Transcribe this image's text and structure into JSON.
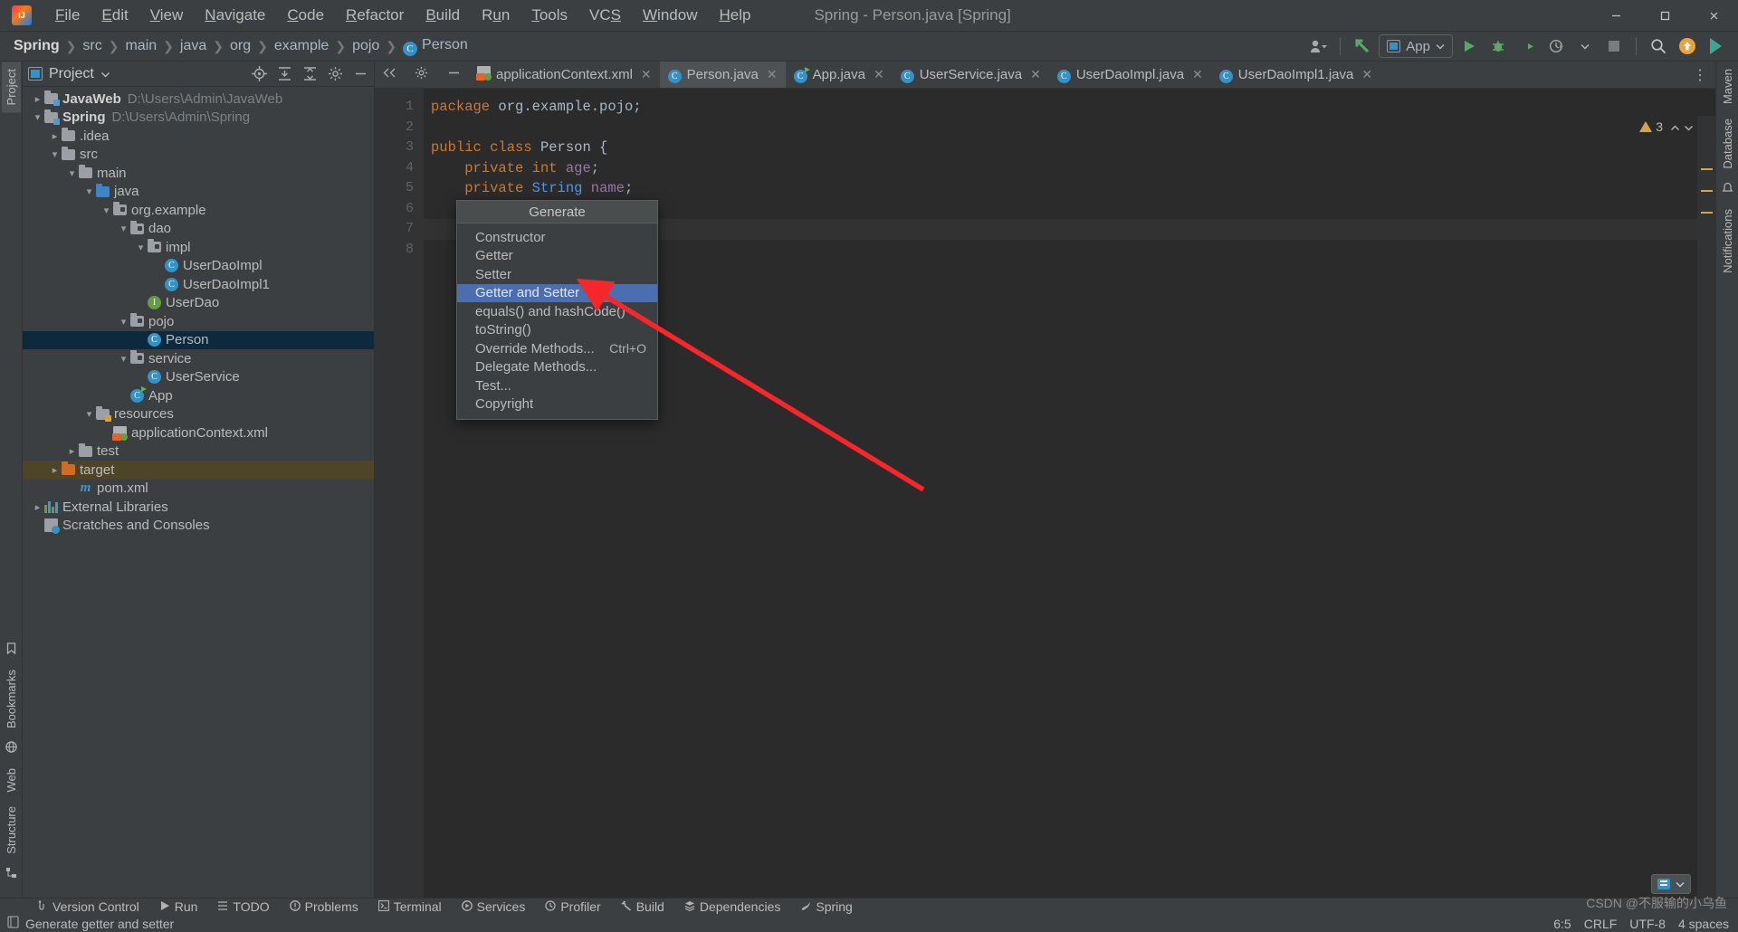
{
  "window": {
    "title": "Spring - Person.java [Spring]",
    "logo_icon": "intellij-idea-logo",
    "minimize_glyph": "─",
    "maximize_glyph": "❐",
    "close_glyph": "✕"
  },
  "menubar": [
    {
      "label": "File",
      "mnemonic": "F"
    },
    {
      "label": "Edit",
      "mnemonic": "E"
    },
    {
      "label": "View",
      "mnemonic": "V"
    },
    {
      "label": "Navigate",
      "mnemonic": "N"
    },
    {
      "label": "Code",
      "mnemonic": "C"
    },
    {
      "label": "Refactor",
      "mnemonic": "R"
    },
    {
      "label": "Build",
      "mnemonic": "B"
    },
    {
      "label": "Run",
      "mnemonic": "u"
    },
    {
      "label": "Tools",
      "mnemonic": "T"
    },
    {
      "label": "VCS",
      "mnemonic": "S"
    },
    {
      "label": "Window",
      "mnemonic": "W"
    },
    {
      "label": "Help",
      "mnemonic": "H"
    }
  ],
  "breadcrumb": [
    {
      "label": "Spring",
      "bold": true,
      "icon": ""
    },
    {
      "label": "src",
      "bold": false,
      "icon": ""
    },
    {
      "label": "main",
      "bold": false,
      "icon": ""
    },
    {
      "label": "java",
      "bold": false,
      "icon": ""
    },
    {
      "label": "org",
      "bold": false,
      "icon": ""
    },
    {
      "label": "example",
      "bold": false,
      "icon": ""
    },
    {
      "label": "pojo",
      "bold": false,
      "icon": ""
    },
    {
      "label": "Person",
      "bold": false,
      "icon": "class-icon"
    }
  ],
  "toolbar": {
    "run_config": "App",
    "run_config_icon": "app-window-icon",
    "user_icon": "user-account-icon",
    "updates_icon": "update-arrow-icon",
    "run_icon": "run-play-icon",
    "debug_icon": "debug-bug-icon",
    "coverage_icon": "run-with-coverage-icon",
    "profiler_icon": "profiler-clock-icon",
    "stop_icon": "stop-square-icon",
    "search_icon": "search-magnifier-icon",
    "notification_icon": "notification-update-icon",
    "ide_icon": "ide-feature-icon"
  },
  "project_panel": {
    "title": "Project",
    "dropdown_icon": "chevron-down-icon",
    "header_icons": [
      "locate-target-icon",
      "expand-all-icon",
      "collapse-all-icon",
      "settings-gear-icon",
      "hide-panel-icon"
    ],
    "tree": [
      {
        "label": "JavaWeb",
        "sub": "D:\\Users\\Admin\\JavaWeb",
        "indent": 0,
        "arrow": "›",
        "icon": "module-folder",
        "bold": true
      },
      {
        "label": "Spring",
        "sub": "D:\\Users\\Admin\\Spring",
        "indent": 0,
        "arrow": "⌄",
        "icon": "module-folder",
        "bold": true
      },
      {
        "label": ".idea",
        "sub": "",
        "indent": 1,
        "arrow": "›",
        "icon": "folder",
        "bold": false
      },
      {
        "label": "src",
        "sub": "",
        "indent": 1,
        "arrow": "⌄",
        "icon": "folder",
        "bold": false
      },
      {
        "label": "main",
        "sub": "",
        "indent": 2,
        "arrow": "⌄",
        "icon": "folder",
        "bold": false
      },
      {
        "label": "java",
        "sub": "",
        "indent": 3,
        "arrow": "⌄",
        "icon": "source-folder",
        "bold": false
      },
      {
        "label": "org.example",
        "sub": "",
        "indent": 4,
        "arrow": "⌄",
        "icon": "package",
        "bold": false
      },
      {
        "label": "dao",
        "sub": "",
        "indent": 5,
        "arrow": "⌄",
        "icon": "package",
        "bold": false
      },
      {
        "label": "impl",
        "sub": "",
        "indent": 6,
        "arrow": "⌄",
        "icon": "package",
        "bold": false
      },
      {
        "label": "UserDaoImpl",
        "sub": "",
        "indent": 7,
        "arrow": "",
        "icon": "class",
        "bold": false
      },
      {
        "label": "UserDaoImpl1",
        "sub": "",
        "indent": 7,
        "arrow": "",
        "icon": "class",
        "bold": false
      },
      {
        "label": "UserDao",
        "sub": "",
        "indent": 6,
        "arrow": "",
        "icon": "interface",
        "bold": false
      },
      {
        "label": "pojo",
        "sub": "",
        "indent": 5,
        "arrow": "⌄",
        "icon": "package",
        "bold": false
      },
      {
        "label": "Person",
        "sub": "",
        "indent": 6,
        "arrow": "",
        "icon": "class",
        "bold": false,
        "state": "selected"
      },
      {
        "label": "service",
        "sub": "",
        "indent": 5,
        "arrow": "⌄",
        "icon": "package",
        "bold": false
      },
      {
        "label": "UserService",
        "sub": "",
        "indent": 6,
        "arrow": "",
        "icon": "class",
        "bold": false
      },
      {
        "label": "App",
        "sub": "",
        "indent": 5,
        "arrow": "",
        "icon": "runnable-class",
        "bold": false
      },
      {
        "label": "resources",
        "sub": "",
        "indent": 3,
        "arrow": "⌄",
        "icon": "resource-folder",
        "bold": false
      },
      {
        "label": "applicationContext.xml",
        "sub": "",
        "indent": 4,
        "arrow": "",
        "icon": "spring-xml",
        "bold": false
      },
      {
        "label": "test",
        "sub": "",
        "indent": 2,
        "arrow": "›",
        "icon": "folder",
        "bold": false
      },
      {
        "label": "target",
        "sub": "",
        "indent": 1,
        "arrow": "›",
        "icon": "target-folder",
        "bold": false,
        "state": "target-hl"
      },
      {
        "label": "pom.xml",
        "sub": "",
        "indent": 2,
        "arrow": "",
        "icon": "maven",
        "bold": false
      },
      {
        "label": "External Libraries",
        "sub": "",
        "indent": 0,
        "arrow": "›",
        "icon": "libraries",
        "bold": false
      },
      {
        "label": "Scratches and Consoles",
        "sub": "",
        "indent": 0,
        "arrow": "",
        "icon": "scratches",
        "bold": false
      }
    ]
  },
  "editor": {
    "tabs": [
      {
        "label": "applicationContext.xml",
        "icon": "spring-xml-icon",
        "active": false
      },
      {
        "label": "Person.java",
        "icon": "class-icon",
        "active": true
      },
      {
        "label": "App.java",
        "icon": "runnable-class-icon",
        "active": false
      },
      {
        "label": "UserService.java",
        "icon": "class-icon",
        "active": false
      },
      {
        "label": "UserDaoImpl.java",
        "icon": "class-icon",
        "active": false
      },
      {
        "label": "UserDaoImpl1.java",
        "icon": "class-icon",
        "active": false
      }
    ],
    "more_tabs_icon": "more-options-icon",
    "line_numbers": [
      "1",
      "2",
      "3",
      "4",
      "5",
      "6",
      "7",
      "8"
    ],
    "code_lines": [
      [
        {
          "t": "package",
          "c": "kw"
        },
        {
          "t": " org.example.pojo;",
          "c": "plain"
        }
      ],
      [],
      [
        {
          "t": "public",
          "c": "kw"
        },
        {
          "t": " ",
          "c": "plain"
        },
        {
          "t": "class",
          "c": "kw"
        },
        {
          "t": " Person {",
          "c": "plain"
        }
      ],
      [
        {
          "t": "    ",
          "c": "plain"
        },
        {
          "t": "private",
          "c": "kw"
        },
        {
          "t": " ",
          "c": "plain"
        },
        {
          "t": "int",
          "c": "kw"
        },
        {
          "t": " ",
          "c": "plain"
        },
        {
          "t": "age",
          "c": "fld"
        },
        {
          "t": ";",
          "c": "plain"
        }
      ],
      [
        {
          "t": "    ",
          "c": "plain"
        },
        {
          "t": "private",
          "c": "kw"
        },
        {
          "t": " ",
          "c": "plain"
        },
        {
          "t": "String",
          "c": "type"
        },
        {
          "t": " ",
          "c": "plain"
        },
        {
          "t": "name",
          "c": "fld"
        },
        {
          "t": ";",
          "c": "plain"
        }
      ],
      [],
      [
        {
          "t": "}",
          "c": "plain"
        }
      ],
      []
    ],
    "warning_count": "3",
    "warning_icon": "warning-triangle-icon",
    "inspection_up_icon": "chevron-up-icon",
    "inspection_down_icon": "chevron-down-icon"
  },
  "generate_popup": {
    "title": "Generate",
    "items": [
      {
        "label": "Constructor",
        "shortcut": "",
        "selected": false
      },
      {
        "label": "Getter",
        "shortcut": "",
        "selected": false
      },
      {
        "label": "Setter",
        "shortcut": "",
        "selected": false
      },
      {
        "label": "Getter and Setter",
        "shortcut": "",
        "selected": true
      },
      {
        "label": "equals() and hashCode()",
        "shortcut": "",
        "selected": false
      },
      {
        "label": "toString()",
        "shortcut": "",
        "selected": false
      },
      {
        "label": "Override Methods...",
        "shortcut": "Ctrl+O",
        "selected": false
      },
      {
        "label": "Delegate Methods...",
        "shortcut": "",
        "selected": false
      },
      {
        "label": "Test...",
        "shortcut": "",
        "selected": false
      },
      {
        "label": "Copyright",
        "shortcut": "",
        "selected": false
      }
    ]
  },
  "annotation": {
    "color": "#f5272a",
    "kind": "arrow-pointing-to-getter-and-setter"
  },
  "left_strip": [
    {
      "label": "Project",
      "icon": "project-icon",
      "active": true
    },
    {
      "label": "Bookmarks",
      "icon": "bookmark-icon",
      "active": false
    },
    {
      "label": "Web",
      "icon": "web-icon",
      "active": false
    },
    {
      "label": "Structure",
      "icon": "structure-icon",
      "active": false
    }
  ],
  "right_strip": [
    {
      "label": "Maven",
      "icon": "maven-icon"
    },
    {
      "label": "Database",
      "icon": "database-icon"
    },
    {
      "label": "Notifications",
      "icon": "notifications-icon"
    }
  ],
  "tool_windows": [
    {
      "label": "Version Control",
      "icon": "vcs-branch-icon"
    },
    {
      "label": "Run",
      "icon": "run-play-icon"
    },
    {
      "label": "TODO",
      "icon": "todo-list-icon"
    },
    {
      "label": "Problems",
      "icon": "problems-icon"
    },
    {
      "label": "Terminal",
      "icon": "terminal-icon"
    },
    {
      "label": "Services",
      "icon": "services-icon"
    },
    {
      "label": "Profiler",
      "icon": "profiler-icon"
    },
    {
      "label": "Build",
      "icon": "build-hammer-icon"
    },
    {
      "label": "Dependencies",
      "icon": "dependencies-icon"
    },
    {
      "label": "Spring",
      "icon": "spring-leaf-icon"
    }
  ],
  "statusbar": {
    "message": "Generate getter and setter",
    "message_icon": "info-document-icon",
    "caret_position": "6:5",
    "line_separator": "CRLF",
    "encoding": "UTF-8",
    "indent": "4 spaces",
    "watermark": "CSDN @不服输的小乌鱼"
  },
  "float_control": {
    "layout_icon": "editor-layout-icon",
    "chevron_icon": "chevron-down-icon"
  }
}
